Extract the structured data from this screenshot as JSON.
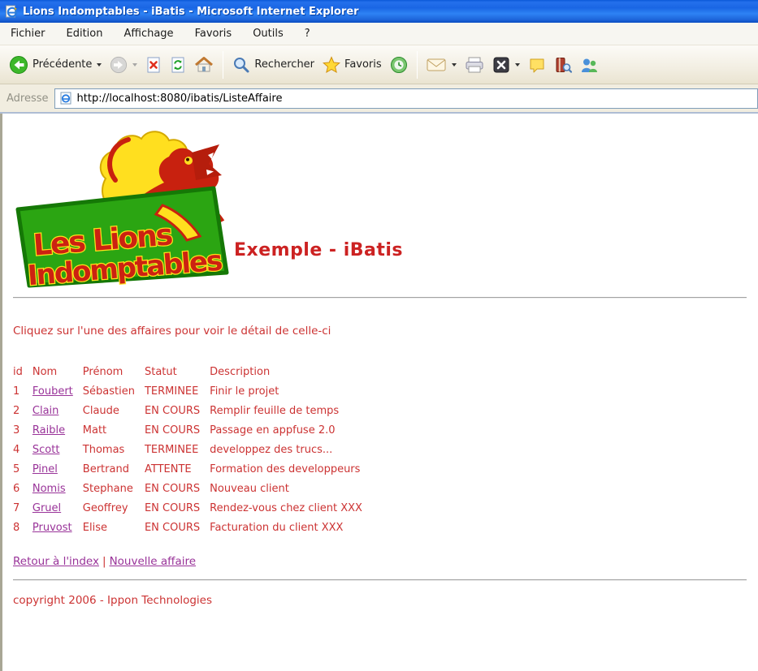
{
  "window": {
    "title": "Lions Indomptables - iBatis - Microsoft Internet Explorer"
  },
  "menu": {
    "items": [
      "Fichier",
      "Edition",
      "Affichage",
      "Favoris",
      "Outils",
      "?"
    ]
  },
  "toolbar": {
    "back_label": "Précédente",
    "search_label": "Rechercher",
    "favorites_label": "Favoris",
    "icons": [
      "back-icon",
      "forward-icon",
      "stop-icon",
      "refresh-icon",
      "home-icon",
      "search-icon",
      "favorites-icon",
      "history-icon",
      "mail-icon",
      "print-icon",
      "edit-icon",
      "discuss-icon",
      "research-icon",
      "messenger-icon"
    ]
  },
  "address": {
    "label": "Adresse",
    "url": "http://localhost:8080/ibatis/ListeAffaire"
  },
  "page": {
    "logo_line1": "Les Lions",
    "logo_line2": "Indomptables",
    "heading": "Exemple - iBatis",
    "instruction": "Cliquez sur l'une des affaires pour voir le détail de celle-ci",
    "footer_link_index": "Retour à l'index",
    "footer_separator": "|",
    "footer_link_new": "Nouvelle affaire",
    "copyright": "copyright 2006 - Ippon Technologies"
  },
  "table": {
    "headers": [
      "id",
      "Nom",
      "Prénom",
      "Statut",
      "Description"
    ],
    "rows": [
      {
        "id": "1",
        "nom": "Foubert",
        "prenom": "Sébastien",
        "statut": "TERMINEE",
        "description": "Finir le projet"
      },
      {
        "id": "2",
        "nom": "Clain",
        "prenom": "Claude",
        "statut": "EN COURS",
        "description": "Remplir feuille de temps"
      },
      {
        "id": "3",
        "nom": "Raible",
        "prenom": "Matt",
        "statut": "EN COURS",
        "description": "Passage en appfuse 2.0"
      },
      {
        "id": "4",
        "nom": "Scott",
        "prenom": "Thomas",
        "statut": "TERMINEE",
        "description": "developpez des trucs..."
      },
      {
        "id": "5",
        "nom": "Pinel",
        "prenom": "Bertrand",
        "statut": "ATTENTE",
        "description": "Formation des developpeurs"
      },
      {
        "id": "6",
        "nom": "Nomis",
        "prenom": "Stephane",
        "statut": "EN COURS",
        "description": "Nouveau client"
      },
      {
        "id": "7",
        "nom": "Gruel",
        "prenom": "Geoffrey",
        "statut": "EN COURS",
        "description": "Rendez-vous chez client XXX"
      },
      {
        "id": "8",
        "nom": "Pruvost",
        "prenom": "Elise",
        "statut": "EN COURS",
        "description": "Facturation du client XXX"
      }
    ]
  },
  "colors": {
    "text_red": "#cc3333",
    "heading_red": "#cc2222",
    "link_purple": "#993399",
    "titlebar_blue": "#1a66e4",
    "toolbar_beige": "#f1ede0",
    "logo_green": "#2ba512",
    "logo_red": "#cc2211",
    "logo_yellow": "#ffe11a"
  }
}
